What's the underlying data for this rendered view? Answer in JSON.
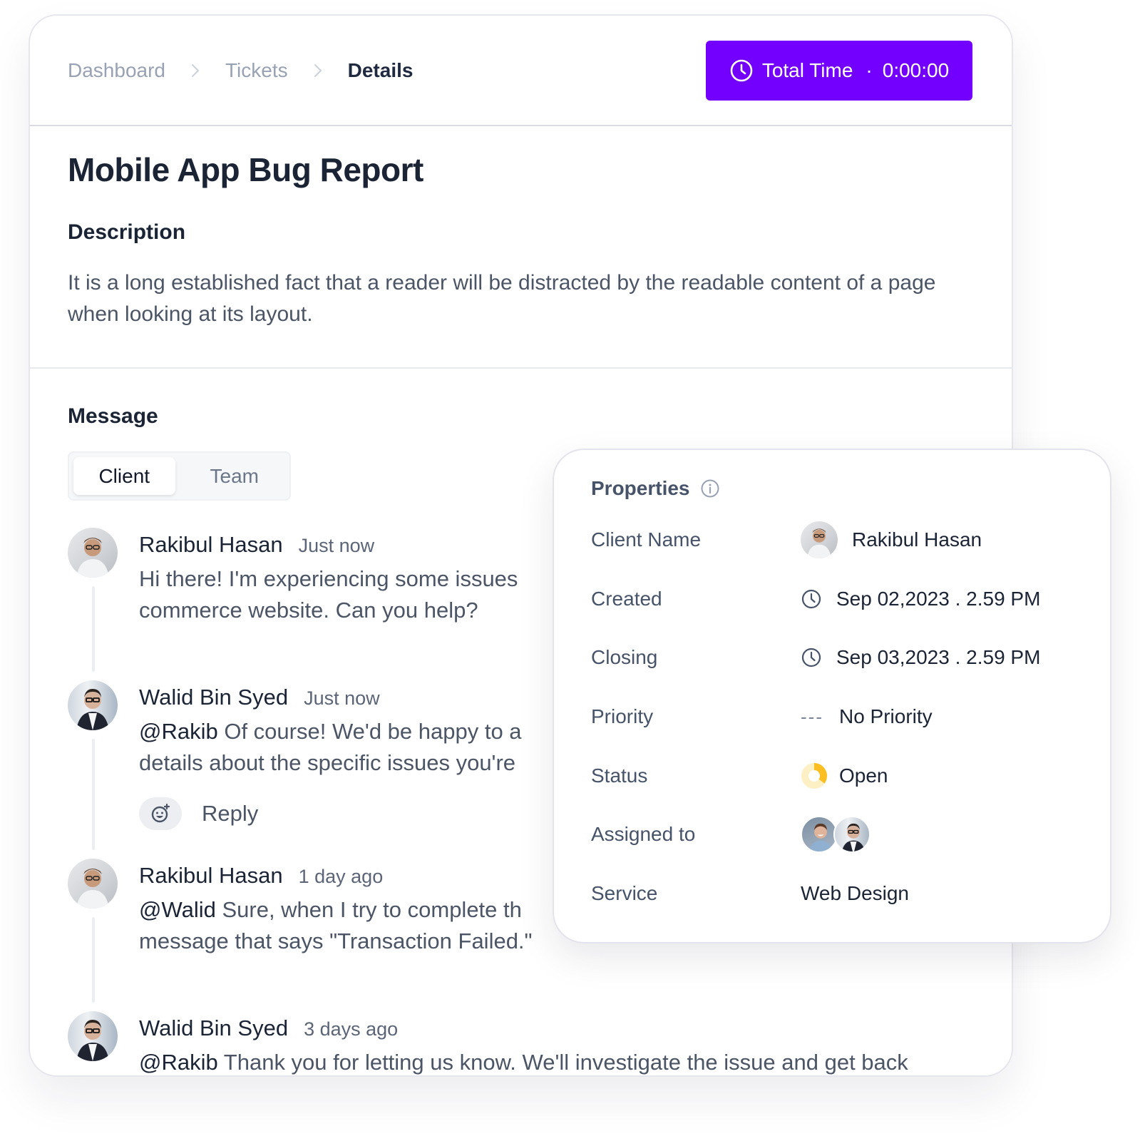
{
  "breadcrumb": {
    "items": [
      "Dashboard",
      "Tickets",
      "Details"
    ]
  },
  "total_time": {
    "label": "Total Time",
    "separator": "·",
    "value": "0:00:00",
    "icon": "clock-icon",
    "color": "#7300ff"
  },
  "ticket": {
    "title": "Mobile App Bug Report",
    "description_label": "Description",
    "description": "It is a long established fact that a reader will be distracted by the readable content of a page when looking at its layout."
  },
  "messages": {
    "label": "Message",
    "tabs": [
      {
        "label": "Client",
        "active": true
      },
      {
        "label": "Team",
        "active": false
      }
    ],
    "thread": [
      {
        "author": "Rakibul Hasan",
        "time": "Just now",
        "mention": "",
        "lines": [
          "Hi there! I'm experiencing some issues",
          "commerce website. Can you help?"
        ]
      },
      {
        "author": "Walid Bin Syed",
        "time": "Just now",
        "mention": "@Rakib",
        "lines": [
          " Of course! We'd be happy to a",
          "details about the specific issues you're"
        ],
        "reply_label": "Reply"
      },
      {
        "author": "Rakibul Hasan",
        "time": "1 day ago",
        "mention": "@Walid",
        "lines": [
          " Sure, when I try to complete th",
          "message that says \"Transaction Failed.\""
        ]
      },
      {
        "author": "Walid Bin Syed",
        "time": "3 days ago",
        "mention": "@Rakib",
        "lines": [
          " Thank you for letting us know. We'll investigate the issue and get back"
        ]
      }
    ]
  },
  "properties": {
    "title": "Properties",
    "rows": {
      "client_name": {
        "label": "Client Name",
        "value": "Rakibul Hasan"
      },
      "created": {
        "label": "Created",
        "value": "Sep 02,2023 . 2.59 PM"
      },
      "closing": {
        "label": "Closing",
        "value": "Sep 03,2023 . 2.59 PM"
      },
      "priority": {
        "label": "Priority",
        "indicator": "---",
        "value": "No Priority"
      },
      "status": {
        "label": "Status",
        "value": "Open",
        "color": "#fbbf24",
        "progress": 0.35
      },
      "assigned_to": {
        "label": "Assigned to",
        "count": 2
      },
      "service": {
        "label": "Service",
        "value": "Web Design"
      }
    }
  }
}
